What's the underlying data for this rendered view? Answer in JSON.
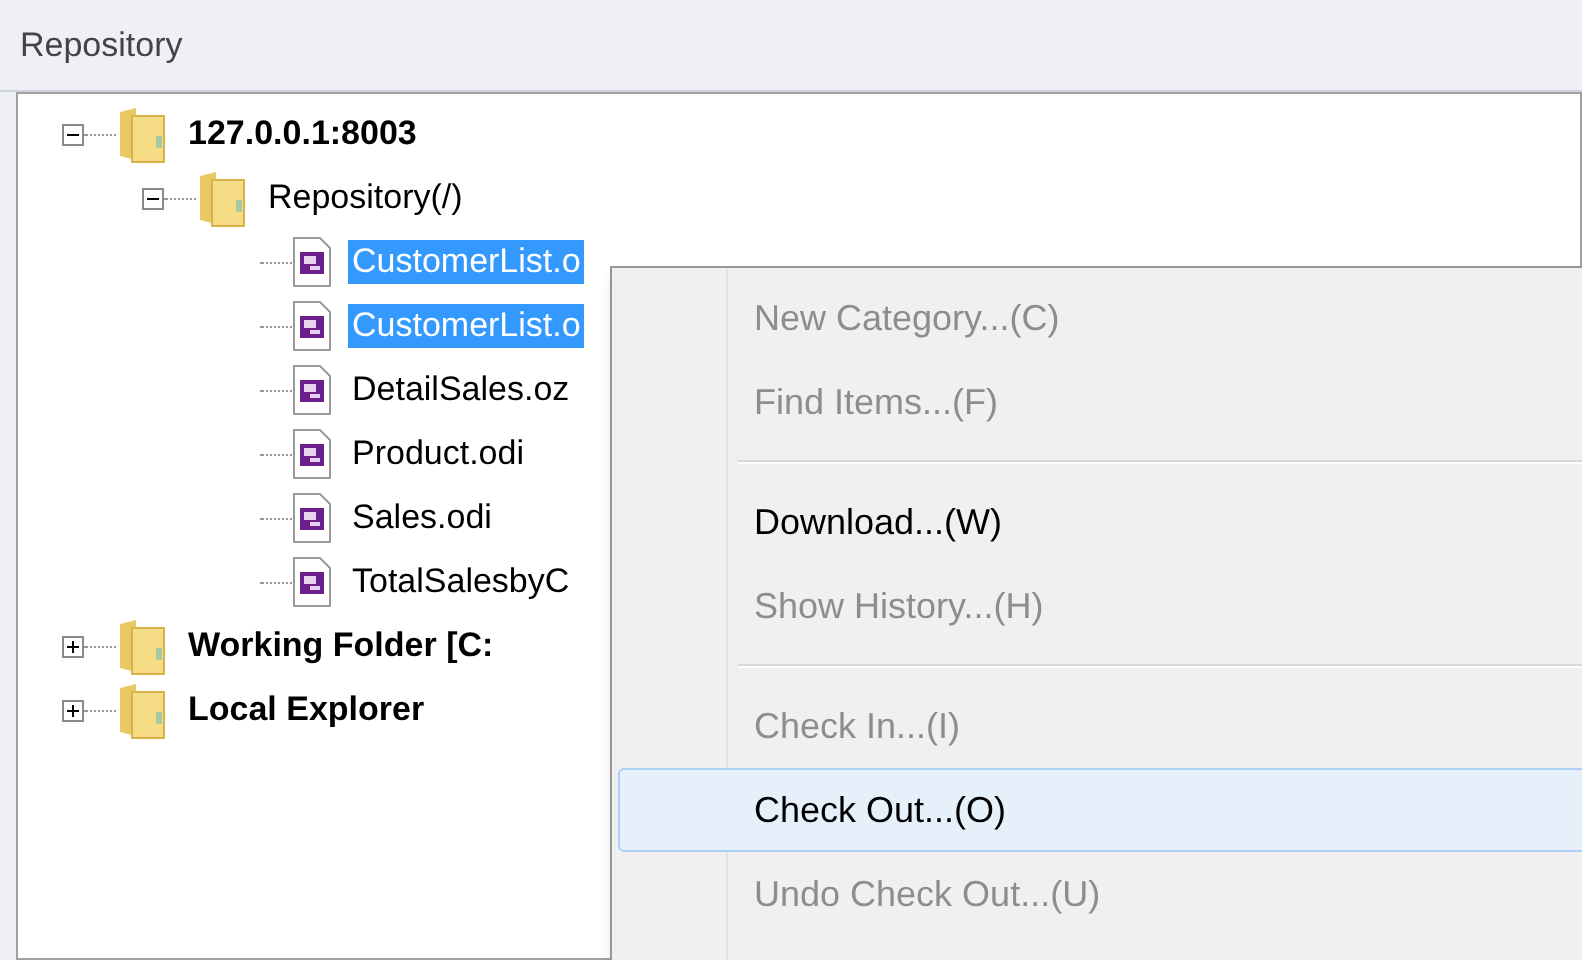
{
  "panel": {
    "title": "Repository"
  },
  "tree": [
    {
      "label": "127.0.0.1:8003",
      "kind": "folder",
      "bold": true,
      "expanded": true,
      "selected": false,
      "children": [
        {
          "label": "Repository(/)",
          "kind": "folder",
          "bold": false,
          "expanded": true,
          "selected": false,
          "children": [
            {
              "label": "CustomerList.o",
              "kind": "file",
              "bold": false,
              "selected": true
            },
            {
              "label": "CustomerList.o",
              "kind": "file",
              "bold": false,
              "selected": true
            },
            {
              "label": "DetailSales.oz",
              "kind": "file",
              "bold": false,
              "selected": false
            },
            {
              "label": "Product.odi",
              "kind": "file",
              "bold": false,
              "selected": false
            },
            {
              "label": "Sales.odi",
              "kind": "file",
              "bold": false,
              "selected": false
            },
            {
              "label": "TotalSalesbyC",
              "kind": "file",
              "bold": false,
              "selected": false
            }
          ]
        }
      ]
    },
    {
      "label": "Working Folder [C:",
      "kind": "folder",
      "bold": true,
      "expanded": false,
      "selected": false
    },
    {
      "label": "Local Explorer",
      "kind": "folder",
      "bold": true,
      "expanded": false,
      "selected": false
    }
  ],
  "context_menu": [
    {
      "kind": "item",
      "label": "New Category...(C)",
      "disabled": true,
      "selected": false
    },
    {
      "kind": "item",
      "label": "Find Items...(F)",
      "disabled": true,
      "selected": false
    },
    {
      "kind": "separator"
    },
    {
      "kind": "item",
      "label": "Download...(W)",
      "disabled": false,
      "selected": false
    },
    {
      "kind": "item",
      "label": "Show History...(H)",
      "disabled": true,
      "selected": false
    },
    {
      "kind": "separator"
    },
    {
      "kind": "item",
      "label": "Check In...(I)",
      "disabled": true,
      "selected": false
    },
    {
      "kind": "item",
      "label": "Check Out...(O)",
      "disabled": false,
      "selected": true
    },
    {
      "kind": "item",
      "label": "Undo Check Out...(U)",
      "disabled": true,
      "selected": false
    }
  ]
}
